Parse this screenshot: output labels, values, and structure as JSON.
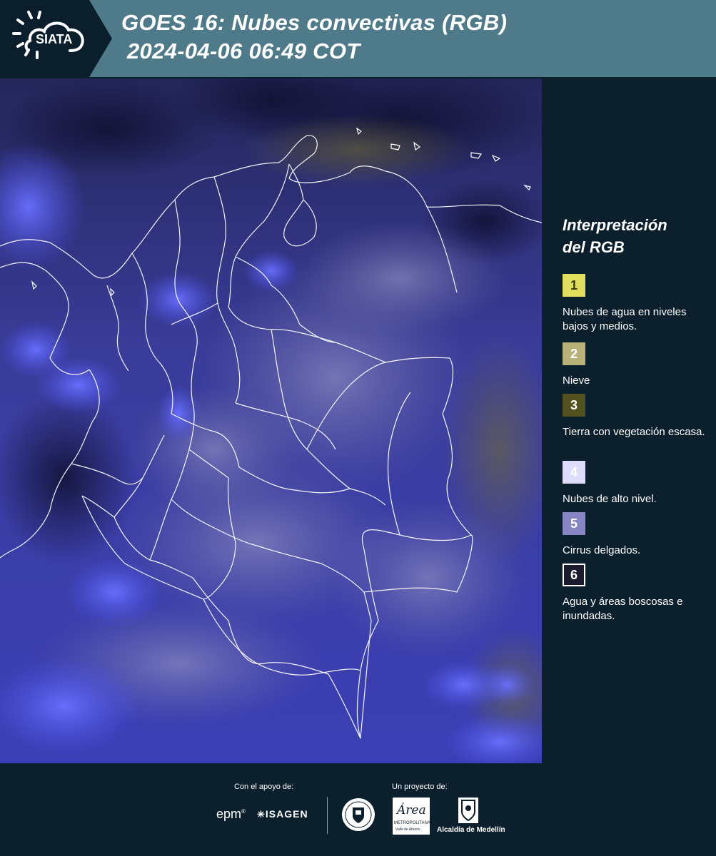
{
  "header": {
    "title_line1": "GOES 16: Nubes convectivas (RGB)",
    "title_line2": "2024-04-06 06:49 COT",
    "logo_text": "SIATA"
  },
  "map": {
    "product": "satellite-rgb-convective-clouds",
    "dominant_color": "#3c3fb0",
    "border_color": "#ffffff"
  },
  "legend": {
    "title_line1": "Interpretación",
    "title_line2": "del RGB",
    "items": [
      {
        "number": "1",
        "label": "Nubes de agua en niveles bajos y medios.",
        "color": "#e0de5c",
        "text_color": "#3a3a10"
      },
      {
        "number": "2",
        "label": "Nieve",
        "color": "#b6b27a",
        "text_color": "#ffffff"
      },
      {
        "number": "3",
        "label": "Tierra con vegetación escasa.",
        "color": "#545120",
        "text_color": "#ffffff"
      },
      {
        "number": "4",
        "label": "Nubes de alto nivel.",
        "color": "#dedcfb",
        "text_color": "#ffffff"
      },
      {
        "number": "5",
        "label": "Cirrus delgados.",
        "color": "#8686c6",
        "text_color": "#ffffff"
      },
      {
        "number": "6",
        "label": "Agua y áreas boscosas e inundadas.",
        "color": "#1c1a2e",
        "text_color": "#ffffff"
      }
    ]
  },
  "footer": {
    "support_caption": "Con el apoyo de:",
    "project_caption": "Un proyecto de:",
    "sponsors": [
      "epm",
      "ISAGEN"
    ],
    "partners": {
      "area_name": "Área",
      "area_sub1": "METROPOLITANA",
      "area_sub2": "Valle de Aburrá",
      "alcaldia": "Alcaldía de Medellín"
    }
  }
}
